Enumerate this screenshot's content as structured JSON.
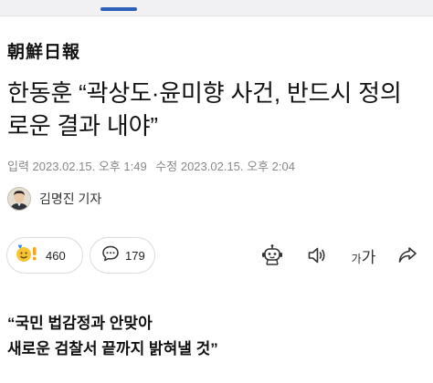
{
  "brand": {
    "logo_text": "朝鮮日報"
  },
  "article": {
    "headline": "한동훈 “곽상도·윤미향 사건, 반드시 정의로운 결과 내야”",
    "published_label": "입력",
    "published_time": "2023.02.15. 오후 1:49",
    "modified_label": "수정",
    "modified_time": "2023.02.15. 오후 2:04",
    "reporter": "김명진 기자",
    "subhead_line1": "“국민 법감정과 안맞아",
    "subhead_line2": "새로운 검찰서 끝까지 밝혀낼 것”"
  },
  "actions": {
    "reaction_count": "460",
    "comment_count": "179",
    "font_size_small": "가",
    "font_size_large": "가"
  },
  "icons": {
    "reaction": "emoji-reaction-icon",
    "comment": "comment-bubble-icon",
    "summary": "robot-summary-icon",
    "audio": "speaker-icon",
    "share": "share-icon"
  },
  "colors": {
    "accent_tab": "#2c5fb8",
    "meta_text": "#888888",
    "pill_border": "#dcdcdf"
  }
}
